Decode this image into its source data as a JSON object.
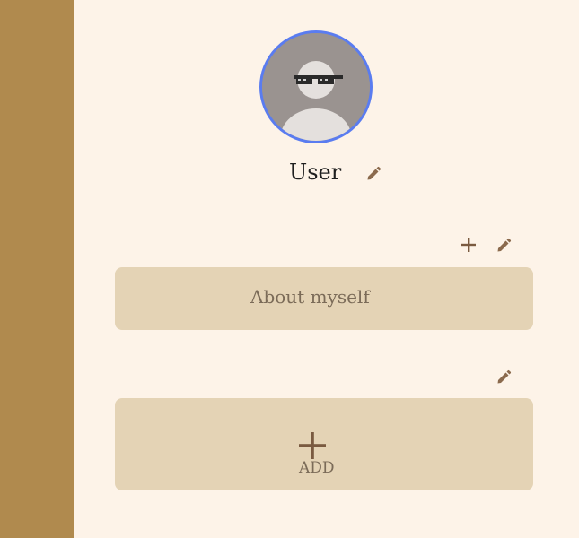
{
  "profile": {
    "username": "User"
  },
  "about": {
    "placeholder": "About myself"
  },
  "add_section": {
    "label": "ADD"
  },
  "icons": {
    "edit_name": "pencil-icon",
    "add_about": "plus-icon",
    "edit_about": "pencil-icon",
    "edit_section": "pencil-icon",
    "add_item": "plus-icon"
  },
  "colors": {
    "sidebar": "#b08a4e",
    "background": "#fdf3e8",
    "card": "#e4d3b5",
    "icon": "#8b6a4d",
    "avatar_ring": "#5a7cf0"
  }
}
